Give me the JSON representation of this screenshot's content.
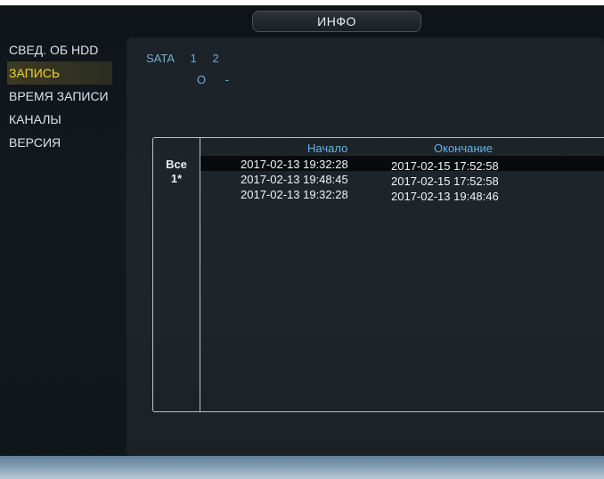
{
  "title": "ИНФО",
  "sidebar": {
    "items": [
      {
        "label": "СВЕД. ОБ HDD"
      },
      {
        "label": "ЗАПИСЬ"
      },
      {
        "label": "ВРЕМЯ ЗАПИСИ"
      },
      {
        "label": "КАНАЛЫ"
      },
      {
        "label": "ВЕРСИЯ"
      }
    ],
    "active_index": 1
  },
  "sata": {
    "label": "SATA",
    "ports": [
      "1",
      "2"
    ],
    "values": [
      "O",
      "-"
    ]
  },
  "table": {
    "headers": {
      "start": "Начало",
      "end": "Окончание"
    },
    "channels": [
      "Все",
      "1*"
    ],
    "rows": [
      {
        "start": "2017-02-13 19:32:28",
        "end": "2017-02-15 17:52:58"
      },
      {
        "start": "2017-02-13 19:48:45",
        "end": "2017-02-15 17:52:58"
      },
      {
        "start": "2017-02-13 19:32:28",
        "end": "2017-02-13 19:48:46"
      }
    ]
  },
  "colors": {
    "accent_active": "#f2d12c",
    "header_text": "#5eb4e6",
    "sata_text": "#74aad0",
    "background": "#121a20"
  }
}
